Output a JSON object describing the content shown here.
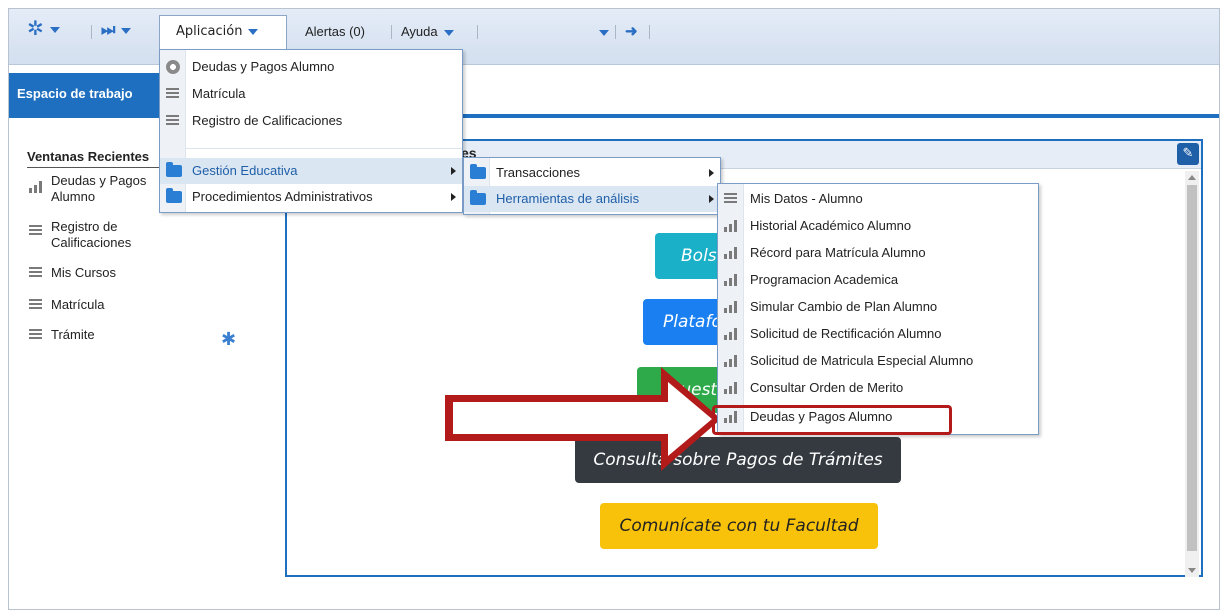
{
  "toolbar": {
    "aplicacion": "Aplicación",
    "alertas": "Alertas (0)",
    "ayuda": "Ayuda"
  },
  "workspace_tab": "Espacio de trabajo",
  "recent": {
    "title": "Ventanas Recientes",
    "items": [
      {
        "label": "Deudas y Pagos",
        "label2": "Alumno",
        "icon": "bar-chart-icon"
      },
      {
        "label": "Registro de",
        "label2": "Calificaciones",
        "icon": "list-icon"
      },
      {
        "label": "Mis Cursos",
        "icon": "list-icon"
      },
      {
        "label": "Matrícula",
        "icon": "list-icon"
      },
      {
        "label": "Trámite",
        "icon": "list-icon"
      }
    ]
  },
  "portlet": {
    "title": "es",
    "buttons": [
      {
        "label": "Bolsa",
        "color": "#1ab0c8"
      },
      {
        "label": "Platafo",
        "color": "#1a7ff0"
      },
      {
        "label": "cuest",
        "color": "#2eaa4a"
      },
      {
        "label": "Consulta sobre Pagos de Trámites",
        "color": "#343a40"
      },
      {
        "label": "Comunícate con tu Facultad",
        "color": "#f9c20a"
      }
    ]
  },
  "menu_app": {
    "items": [
      {
        "label": "Deudas y Pagos Alumno",
        "icon": "gear-icon"
      },
      {
        "label": "Matrícula",
        "icon": "list-icon"
      },
      {
        "label": "Registro de Calificaciones",
        "icon": "list-icon"
      },
      {
        "label": "Gestión Educativa",
        "icon": "folder-icon"
      },
      {
        "label": "Procedimientos Administrativos",
        "icon": "folder-icon"
      }
    ]
  },
  "menu_gestion": {
    "items": [
      {
        "label": "Transacciones",
        "icon": "folder-icon"
      },
      {
        "label": "Herramientas de análisis",
        "icon": "folder-icon"
      }
    ]
  },
  "menu_herramientas": {
    "items": [
      {
        "label": "Mis Datos - Alumno",
        "icon": "list-icon"
      },
      {
        "label": "Historial Académico Alumno",
        "icon": "bar-chart-icon"
      },
      {
        "label": "Récord para Matrícula Alumno",
        "icon": "bar-chart-icon"
      },
      {
        "label": "Programacion Academica",
        "icon": "bar-chart-icon"
      },
      {
        "label": "Simular Cambio de Plan Alumno",
        "icon": "bar-chart-icon"
      },
      {
        "label": "Solicitud de Rectificación Alumno",
        "icon": "bar-chart-icon"
      },
      {
        "label": "Solicitud de Matricula Especial Alumno",
        "icon": "bar-chart-icon"
      },
      {
        "label": "Consultar Orden de Merito",
        "icon": "bar-chart-icon"
      },
      {
        "label": "Deudas y Pagos Alumno",
        "icon": "bar-chart-icon"
      }
    ]
  },
  "colors": {
    "accent": "#1e6fbf",
    "highlight": "#b31b1b"
  }
}
